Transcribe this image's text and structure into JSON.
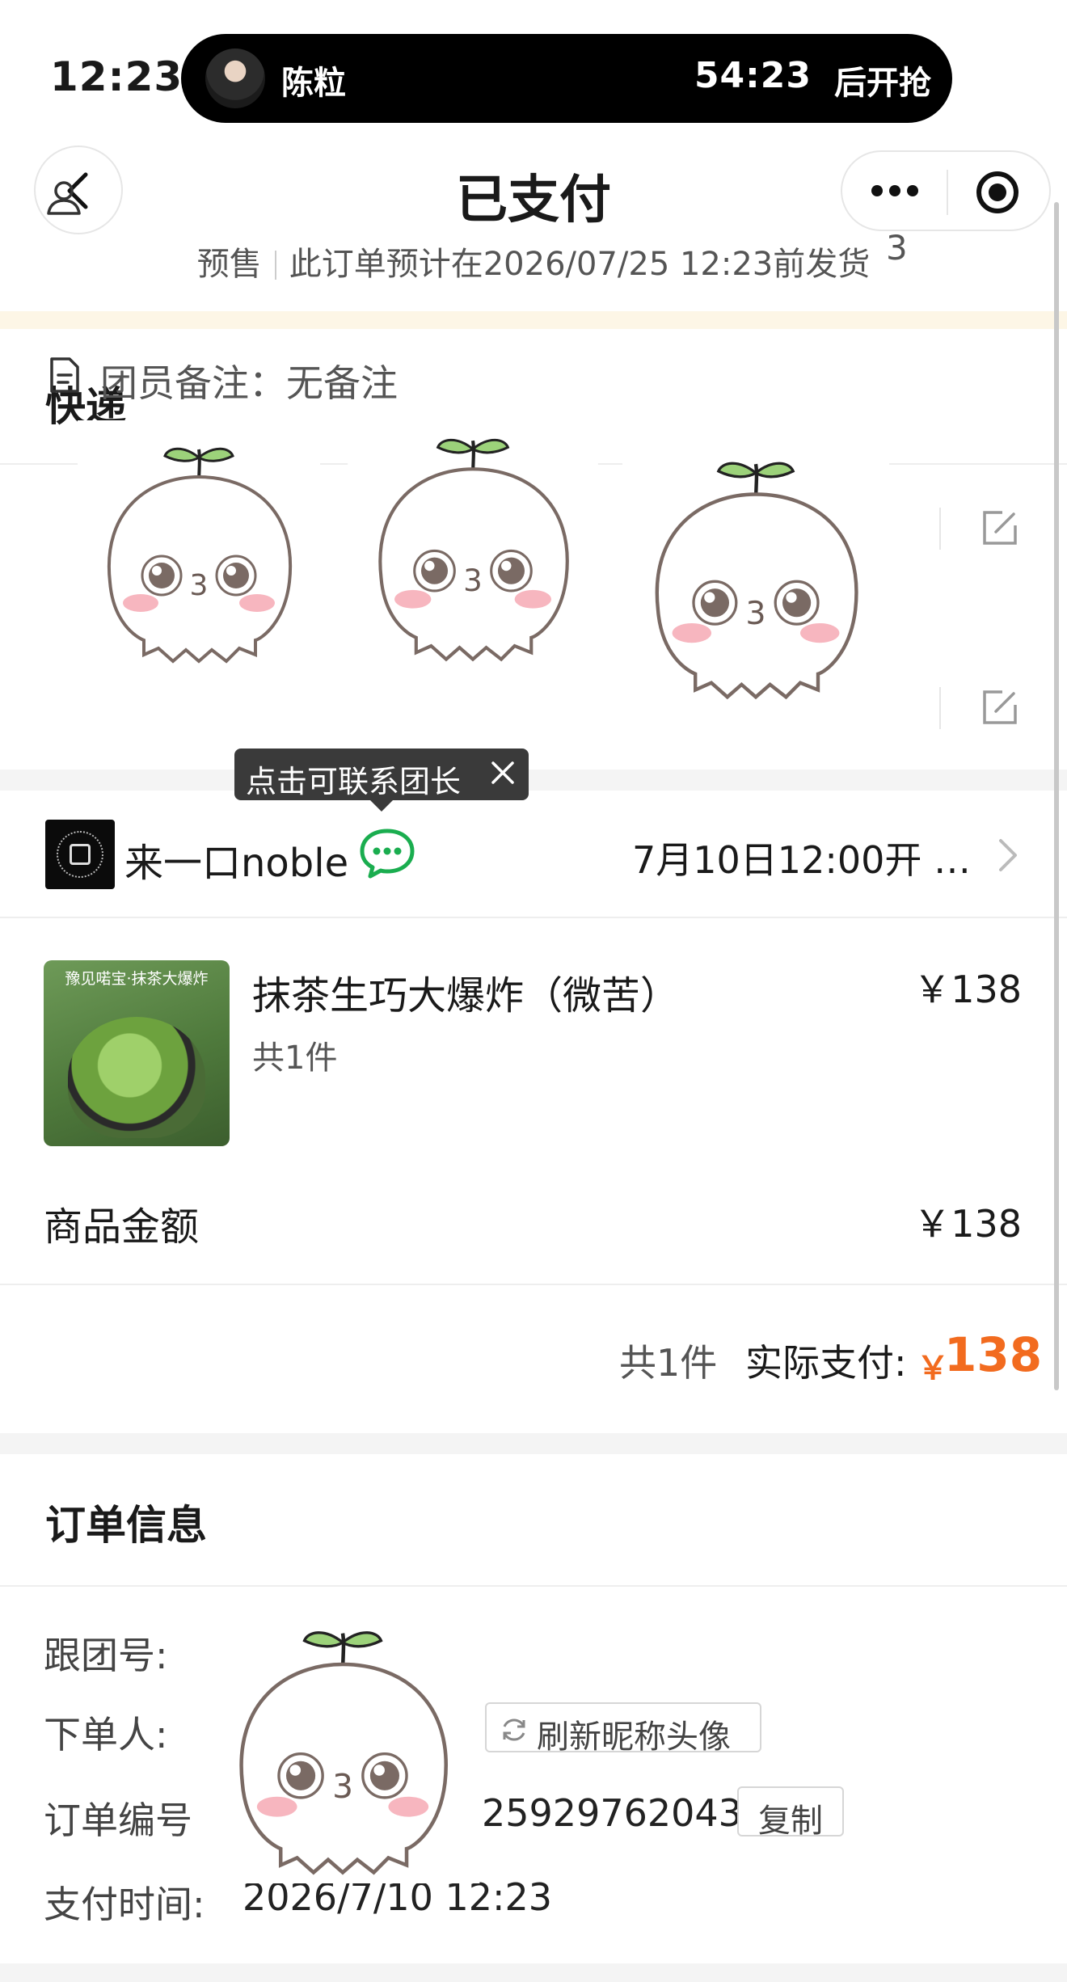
{
  "status_bar": {
    "time": "12:23",
    "live": {
      "host_name": "陈粒",
      "countdown": "54:23",
      "countdown_suffix": "后开抢"
    }
  },
  "nav": {
    "title": "已支付"
  },
  "presale": {
    "tag": "预售",
    "message": "此订单预计在2026/07/25 12:23前发货"
  },
  "delivery": {
    "title": "快递",
    "masked_digit": "3",
    "member_note": "团员备注：无备注"
  },
  "tooltip": {
    "text": "点击可联系团长"
  },
  "shop": {
    "name": "来一口noble",
    "open_time": "7月10日12:00开 …"
  },
  "product": {
    "image_banner": "豫见喏宝·抹茶大爆炸",
    "name": "抹茶生巧大爆炸（微苦）",
    "price": "￥138",
    "count": "共1件"
  },
  "amount": {
    "label": "商品金额",
    "value": "￥138"
  },
  "total": {
    "count": "共1件",
    "label": "实际支付:",
    "currency": "￥",
    "value": "138"
  },
  "order_info": {
    "title": "订单信息",
    "group_no_label": "跟团号:",
    "buyer_label": "下单人:",
    "refresh_button": "刷新昵称头像",
    "order_no_label": "订单编号",
    "order_no_value": "25929762043",
    "copy_button": "复制",
    "paid_time_label": "支付时间:",
    "paid_time_value": "2026/7/10 12:23"
  },
  "colors": {
    "accent_orange": "#f26b1f",
    "chat_green": "#1aad4f",
    "tooltip_bg": "#3a3a3a"
  }
}
